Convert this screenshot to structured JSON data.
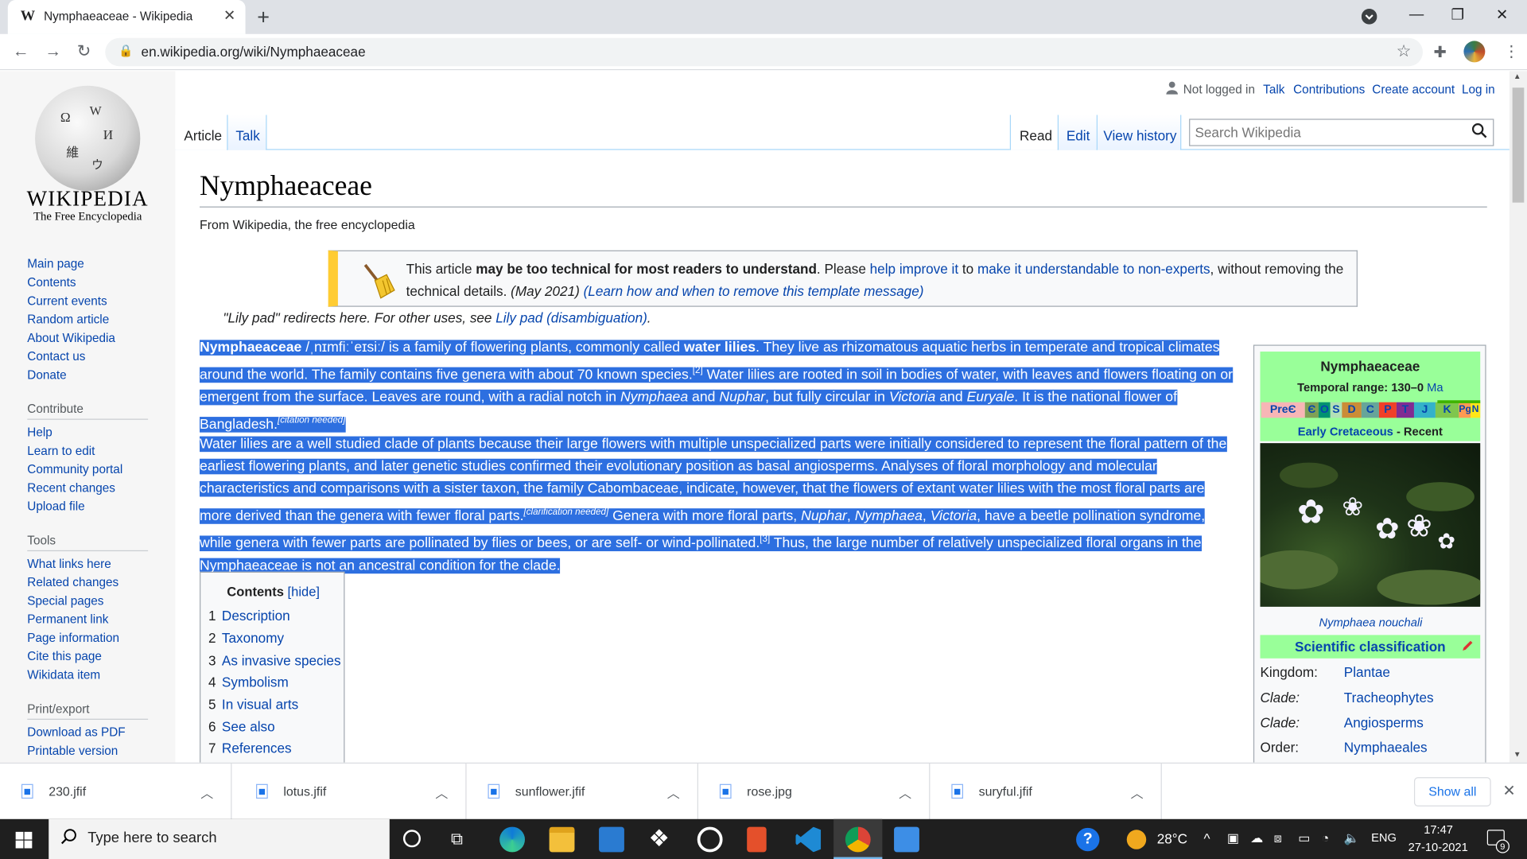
{
  "browser": {
    "tab_title": "Nymphaeaceae - Wikipedia",
    "tab_favicon": "W",
    "url": "en.wikipedia.org/wiki/Nymphaeaceae"
  },
  "wiki": {
    "logo": {
      "wordmark": "WIKIPEDIA",
      "tagline": "The Free Encyclopedia"
    },
    "nav_main": [
      "Main page",
      "Contents",
      "Current events",
      "Random article",
      "About Wikipedia",
      "Contact us",
      "Donate"
    ],
    "contribute": {
      "heading": "Contribute",
      "items": [
        "Help",
        "Learn to edit",
        "Community portal",
        "Recent changes",
        "Upload file"
      ]
    },
    "tools": {
      "heading": "Tools",
      "items": [
        "What links here",
        "Related changes",
        "Special pages",
        "Permanent link",
        "Page information",
        "Cite this page",
        "Wikidata item"
      ]
    },
    "print": {
      "heading": "Print/export",
      "items": [
        "Download as PDF",
        "Printable version"
      ]
    },
    "personal": {
      "status": "Not logged in",
      "talk": "Talk",
      "contributions": "Contributions",
      "create": "Create account",
      "login": "Log in"
    },
    "tabs": {
      "article": "Article",
      "talk": "Talk",
      "read": "Read",
      "edit": "Edit",
      "history": "View history"
    },
    "search_placeholder": "Search Wikipedia",
    "title": "Nymphaeaceae",
    "from": "From Wikipedia, the free encyclopedia",
    "ambox": {
      "t1": "This article ",
      "t2": "may be too technical for most readers to understand",
      "t3": ". Please ",
      "l1": "help improve it",
      "t4": " to ",
      "l2": "make it understandable to non-experts",
      "t5": ", without removing the technical details. ",
      "date": "(May 2021)",
      "l3": "(Learn how and when to remove this template message)"
    },
    "hatnote": {
      "text": "\"Lily pad\" redirects here. For other uses, see ",
      "link": "Lily pad (disambiguation)",
      "end": "."
    },
    "p1": {
      "name": "Nymphaeaceae",
      "ipa": " /ˌnɪmfiːˈeɪsiː/",
      "a": " is a family of flowering plants, commonly called ",
      "water_lilies": "water lilies",
      "b": ". They live as rhizomatous aquatic herbs in temperate and tropical climates around the world. The family contains five genera with about 70 known species.",
      "ref2": "[2]",
      "c": " Water lilies are rooted in soil in bodies of water, with leaves and flowers floating on or emergent from the surface. Leaves are round, with a radial notch in ",
      "nymphaea": "Nymphaea",
      "and1": " and ",
      "nuphar": "Nuphar",
      "d": ", but fully circular in ",
      "victoria": "Victoria",
      "and2": " and ",
      "euryale": "Euryale",
      "e": ". It is the national flower of Bangladesh.",
      "cite": "[citation needed]"
    },
    "p2": {
      "a": "Water lilies are a well studied clade of plants because their large flowers with multiple unspecialized parts were initially considered to represent the floral pattern of the earliest flowering plants, and later genetic studies confirmed their evolutionary position as basal angiosperms. Analyses of floral morphology and molecular characteristics and comparisons with a sister taxon, the family Cabombaceae, indicate, however, that the flowers of extant water lilies with the most floral parts are more derived than the genera with fewer floral parts.",
      "clar": "[clarification needed]",
      "b": " Genera with more floral parts, ",
      "nuphar": "Nuphar",
      "comma1": ", ",
      "nymphaea": "Nymphaea",
      "comma2": ", ",
      "victoria": "Victoria",
      "c": ", have a beetle pollination syndrome, while genera with fewer parts are pollinated by flies or bees, or are self- or wind-pollinated.",
      "ref3": "[3]",
      "d": " Thus, the large number of relatively unspecialized floral organs in the Nymphaeaceae is not an ancestral condition for the clade."
    },
    "toc": {
      "title": "Contents",
      "hide": "[hide]",
      "items": [
        {
          "num": "1",
          "label": "Description"
        },
        {
          "num": "2",
          "label": "Taxonomy"
        },
        {
          "num": "3",
          "label": "As invasive species"
        },
        {
          "num": "4",
          "label": "Symbolism"
        },
        {
          "num": "5",
          "label": "In visual arts"
        },
        {
          "num": "6",
          "label": "See also"
        },
        {
          "num": "7",
          "label": "References"
        }
      ]
    },
    "infobox": {
      "name": "Nymphaeaceae",
      "range_label": "Temporal range: 130–0 ",
      "range_unit": "Ma",
      "periods": [
        "PreЄ",
        "Є",
        "O",
        "S",
        "D",
        "C",
        "P",
        "T",
        "J",
        "K",
        "Pg",
        "N"
      ],
      "era_start": "Early Cretaceous",
      "era_sep": " - ",
      "era_end": "Recent",
      "caption": "Nymphaea nouchali",
      "sci_heading": "Scientific classification",
      "taxonomy": [
        {
          "rank": "Kingdom:",
          "value": "Plantae",
          "italic": false
        },
        {
          "rank": "Clade:",
          "value": "Tracheophytes",
          "italic": true
        },
        {
          "rank": "Clade:",
          "value": "Angiosperms",
          "italic": true
        },
        {
          "rank": "Order:",
          "value": "Nymphaeales",
          "italic": false
        }
      ]
    }
  },
  "downloads": {
    "files": [
      "230.jfif",
      "lotus.jfif",
      "sunflower.jfif",
      "rose.jpg",
      "suryful.jfif"
    ],
    "show_all": "Show all"
  },
  "taskbar": {
    "search_placeholder": "Type here to search",
    "temperature": "28°C",
    "language": "ENG",
    "time": "17:47",
    "date": "27-10-2021",
    "notifications": "9"
  },
  "colors": {
    "selection": "#2d6fe0",
    "link": "#0645ad",
    "infobox_header": "#99ff99",
    "ambox_bar": "#ffcc33"
  }
}
